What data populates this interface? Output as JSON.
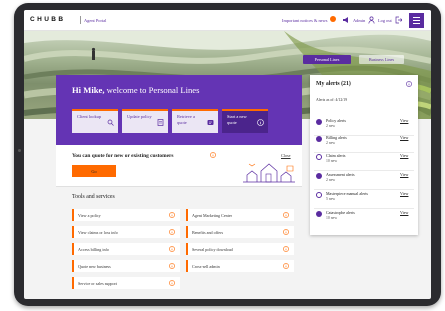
{
  "header": {
    "logo": "CHUBB",
    "portal": "Agent Portal",
    "notifications": "Important notices & news",
    "admin": "Admin",
    "logout": "Log out"
  },
  "hero_tabs": [
    "Personal Lines",
    "Business Lines"
  ],
  "welcome": {
    "greeting_name": "Hi Mike,",
    "greeting_rest": " welcome to Personal Lines",
    "actions": [
      {
        "label": "Client lookup",
        "icon": "search-icon"
      },
      {
        "label": "Update policy",
        "icon": "document-icon"
      },
      {
        "label": "Retrieve a quote",
        "icon": "quote-icon"
      },
      {
        "label": "Start a new quote",
        "icon": "info-icon"
      }
    ]
  },
  "quote_card": {
    "text": "You can quote for new or existing customers",
    "close": "Close",
    "go": "Go"
  },
  "tools": {
    "title": "Tools and services",
    "left": [
      "View a policy",
      "View claims or loss info",
      "Access billing info",
      "Quote new business",
      "Service or sales support"
    ],
    "right": [
      "Agent Marketing Center",
      "Benefits and offers",
      "Several policy download",
      "Cross-sell admin"
    ]
  },
  "alerts": {
    "title": "My alerts (21)",
    "as_of": "Alerts as of: 4/12/19",
    "items": [
      {
        "label": "Policy alerts",
        "count": "2 new",
        "view": "View"
      },
      {
        "label": "Billing alerts",
        "count": "2 new",
        "view": "View"
      },
      {
        "label": "Claim alerts",
        "count": "10 new",
        "view": "View"
      },
      {
        "label": "Assessment alerts",
        "count": "2 new",
        "view": "View"
      },
      {
        "label": "Masterpiece manual alerts",
        "count": "5 new",
        "view": "View"
      },
      {
        "label": "Catastrophe alerts",
        "count": "10 new",
        "view": "View"
      }
    ]
  },
  "colors": {
    "brand_purple": "#5a2ca0",
    "accent_orange": "#ff6a00"
  }
}
